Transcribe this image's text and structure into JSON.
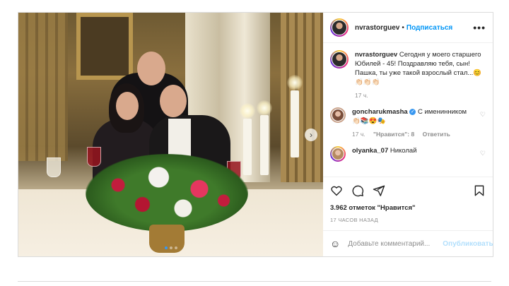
{
  "post": {
    "author": {
      "username": "nvrastorguev",
      "follow_separator": "•",
      "follow_label": "Подписаться"
    },
    "caption": {
      "username": "nvrastorguev",
      "text": "Сегодня у моего старшего Юбилей - 45! Поздравляю тебя, сын!Пашка, ты уже такой взрослый стал...😊👏🏻👏🏻👏🏻",
      "time": "17 ч."
    },
    "comments": [
      {
        "username": "goncharukmasha",
        "verified_icon": "✓",
        "text": "С именинником 👏🏻📚😍🎭",
        "time": "17 ч.",
        "likes_label": "\"Нравится\": 8",
        "reply_label": "Ответить"
      },
      {
        "username": "olyanka_07",
        "text": "Николай"
      }
    ],
    "likes": "3.962 отметок \"Нравится\"",
    "posted_ago": "17 ЧАСОВ НАЗАД",
    "add_comment": {
      "placeholder": "Добавьте комментарий...",
      "publish_label": "Опубликовать"
    },
    "carousel": {
      "next_arrow": "›",
      "slide_count": 3,
      "active_index": 0
    },
    "more_icon": "•••",
    "emoji_icon": "☺",
    "heart_small_icon": "♡"
  },
  "colors": {
    "link_blue": "#0095f6",
    "publish_disabled": "#b2dffc",
    "muted_text": "#8e8e8e",
    "border": "#dbdbdb"
  }
}
